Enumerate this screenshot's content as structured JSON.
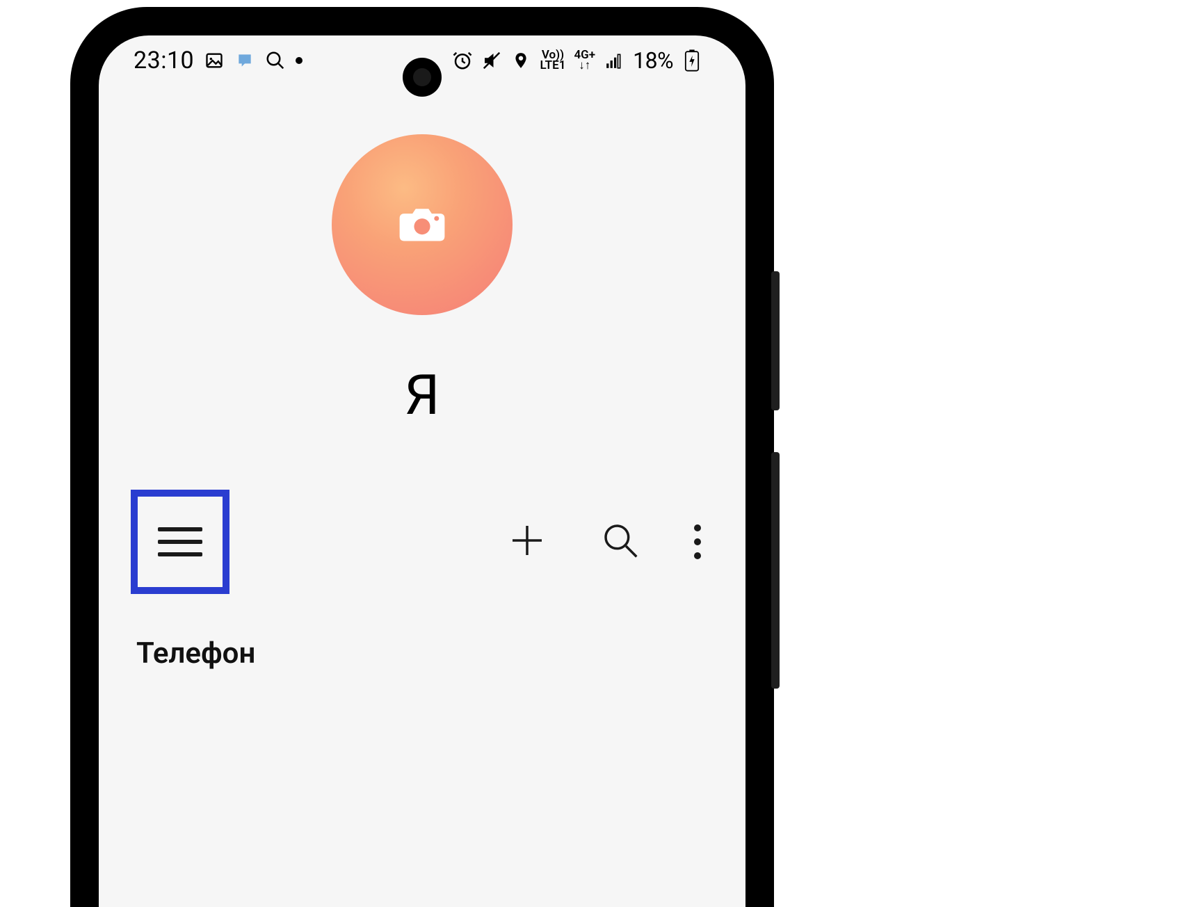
{
  "status_bar": {
    "time": "23:10",
    "battery_percent": "18%",
    "network_label_top": "Vo))",
    "network_label_bottom": "LTE1",
    "data_label_top": "4G+",
    "data_label_bottom": "↓↑"
  },
  "profile": {
    "name": "Я"
  },
  "list": {
    "section_header": "Телефон"
  },
  "colors": {
    "highlight_box": "#2a3dd0",
    "avatar_gradient_start": "#fcbb84",
    "avatar_gradient_end": "#f57e78"
  }
}
